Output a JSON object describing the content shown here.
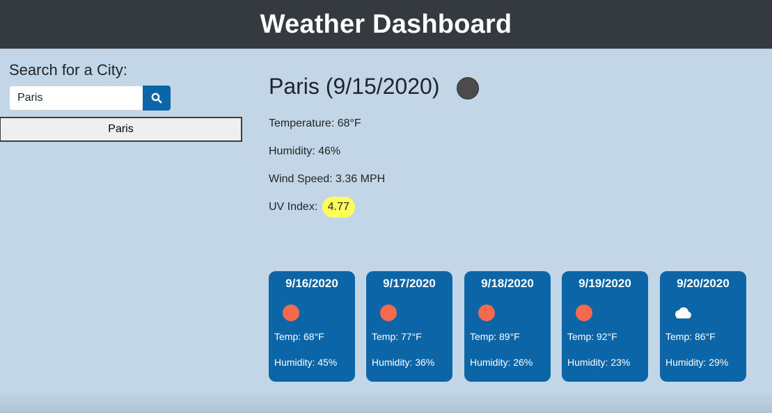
{
  "header": {
    "title": "Weather Dashboard"
  },
  "search": {
    "label": "Search for a City:",
    "value": "Paris",
    "button_icon": "search-icon"
  },
  "history": [
    "Paris"
  ],
  "current": {
    "title": "Paris (9/15/2020)",
    "icon": "moon-icon",
    "temperature": "Temperature: 68°F",
    "humidity": "Humidity: 46%",
    "wind": "Wind Speed: 3.36 MPH",
    "uv_label": "UV Index:",
    "uv_value": "4.77",
    "uv_color": "#ffff59"
  },
  "forecast": [
    {
      "date": "9/16/2020",
      "icon": "sun-icon",
      "temp": "Temp: 68°F",
      "humidity": "Humidity: 45%"
    },
    {
      "date": "9/17/2020",
      "icon": "sun-icon",
      "temp": "Temp: 77°F",
      "humidity": "Humidity: 36%"
    },
    {
      "date": "9/18/2020",
      "icon": "sun-icon",
      "temp": "Temp: 89°F",
      "humidity": "Humidity: 26%"
    },
    {
      "date": "9/19/2020",
      "icon": "sun-icon",
      "temp": "Temp: 92°F",
      "humidity": "Humidity: 23%"
    },
    {
      "date": "9/20/2020",
      "icon": "cloud-icon",
      "temp": "Temp: 86°F",
      "humidity": "Humidity: 29%"
    }
  ],
  "colors": {
    "header_bg": "#343a40",
    "page_bg": "#c3d6e7",
    "card_bg": "#0b65a6",
    "accent": "#0b65a6"
  }
}
